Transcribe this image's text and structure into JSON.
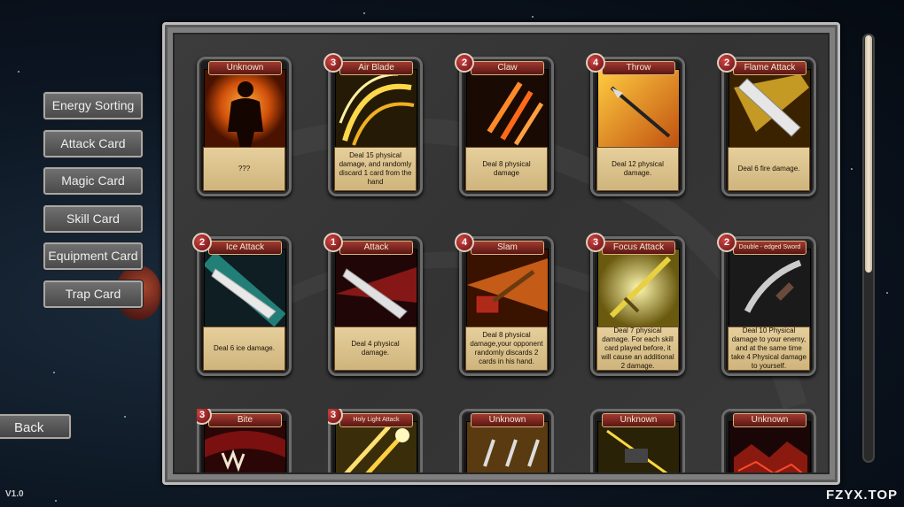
{
  "menu": {
    "items": [
      {
        "label": "Energy Sorting"
      },
      {
        "label": "Attack Card"
      },
      {
        "label": "Magic Card"
      },
      {
        "label": "Skill Card"
      },
      {
        "label": "Equipment Card"
      },
      {
        "label": "Trap Card"
      }
    ],
    "back_label": "Back"
  },
  "version": "V1.0",
  "watermark": "FZYX.TOP",
  "cards": [
    {
      "title": "Unknown",
      "cost": "",
      "art": "silhouette",
      "desc": "???"
    },
    {
      "title": "Air Blade",
      "cost": "3",
      "art": "airblade",
      "desc": "Deal 15 physical damage, and randomly discard 1 card from the hand"
    },
    {
      "title": "Claw",
      "cost": "2",
      "art": "claw",
      "desc": "Deal 8 physical damage"
    },
    {
      "title": "Throw",
      "cost": "4",
      "art": "throw",
      "desc": "Deal 12 physical damage."
    },
    {
      "title": "Flame Attack",
      "cost": "2",
      "art": "flame",
      "desc": "Deal 6 fire damage."
    },
    {
      "title": "Ice Attack",
      "cost": "2",
      "art": "ice",
      "desc": "Deal 6 ice damage."
    },
    {
      "title": "Attack",
      "cost": "1",
      "art": "attack",
      "desc": "Deal 4 physical damage."
    },
    {
      "title": "Slam",
      "cost": "4",
      "art": "slam",
      "desc": "Deal 8 physical damage,your opponent randomly discards 2 cards in his hand."
    },
    {
      "title": "Focus Attack",
      "cost": "3",
      "art": "focus",
      "desc": "Deal 7 physical damage. For each skill card played before, it will cause an additional 2 damage."
    },
    {
      "title": "Double - edged Sword",
      "cost": "2",
      "art": "double",
      "desc": "Deal 10 Physical damage to your enemy, and at the same time take 4 Physical damage to yourself."
    },
    {
      "title": "Bite",
      "cost": "3",
      "art": "bite",
      "desc": ""
    },
    {
      "title": "Holy Light Attack",
      "cost": "3",
      "art": "holy",
      "desc": ""
    },
    {
      "title": "Unknown",
      "cost": "",
      "art": "daggers",
      "desc": ""
    },
    {
      "title": "Unknown",
      "cost": "",
      "art": "hammer",
      "desc": ""
    },
    {
      "title": "Unknown",
      "cost": "",
      "art": "rocks",
      "desc": ""
    }
  ]
}
